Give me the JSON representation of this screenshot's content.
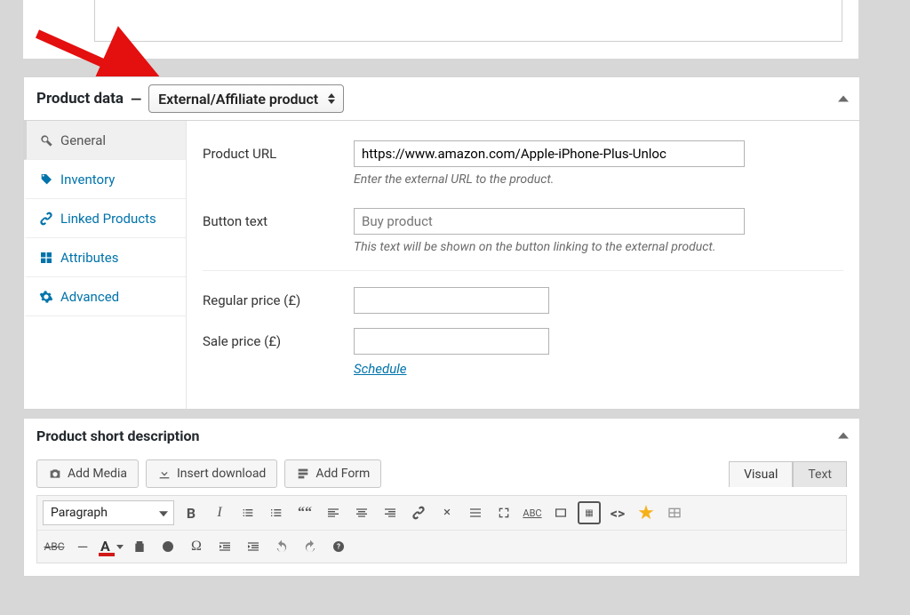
{
  "product_data": {
    "title": "Product data",
    "type_selected": "External/Affiliate product",
    "tabs": {
      "general": "General",
      "inventory": "Inventory",
      "linked": "Linked Products",
      "attributes": "Attributes",
      "advanced": "Advanced"
    },
    "fields": {
      "product_url": {
        "label": "Product URL",
        "value": "https://www.amazon.com/Apple-iPhone-Plus-Unloc",
        "help": "Enter the external URL to the product."
      },
      "button_text": {
        "label": "Button text",
        "placeholder": "Buy product",
        "help": "This text will be shown on the button linking to the external product."
      },
      "regular_price": {
        "label": "Regular price (£)"
      },
      "sale_price": {
        "label": "Sale price (£)",
        "schedule": "Schedule"
      }
    }
  },
  "short_desc": {
    "title": "Product short description",
    "buttons": {
      "add_media": "Add Media",
      "insert_download": "Insert download",
      "add_form": "Add Form"
    },
    "tabs": {
      "visual": "Visual",
      "text": "Text"
    },
    "paragraph": "Paragraph"
  }
}
